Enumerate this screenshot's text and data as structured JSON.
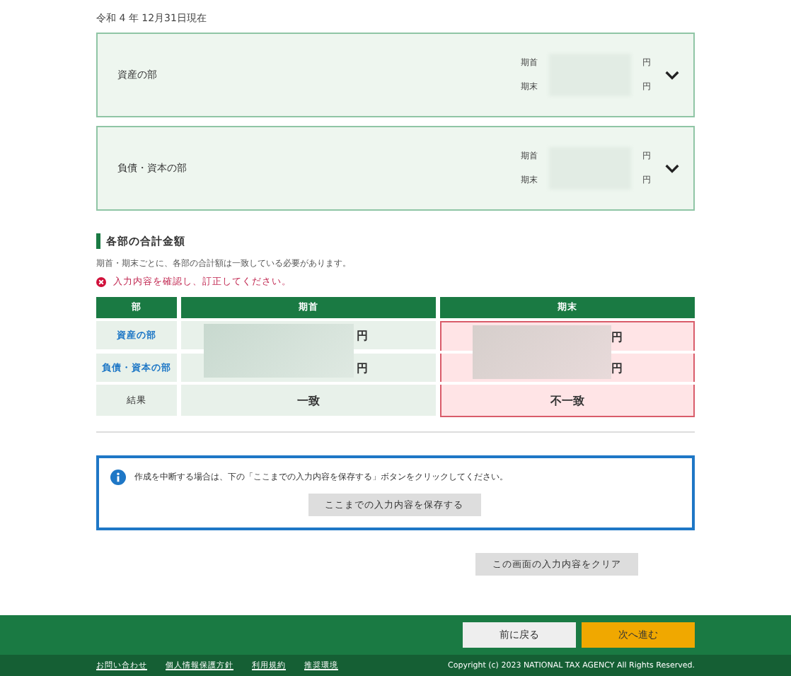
{
  "date": "令和 4 年 12月31日現在",
  "panels": [
    {
      "title": "資産の部",
      "rows": [
        {
          "label": "期首",
          "unit": "円"
        },
        {
          "label": "期末",
          "unit": "円"
        }
      ],
      "expanded": false
    },
    {
      "title": "負債・資本の部",
      "rows": [
        {
          "label": "期首",
          "unit": "円"
        },
        {
          "label": "期末",
          "unit": "円"
        }
      ],
      "expanded": false
    }
  ],
  "totals": {
    "heading": "各部の合計金額",
    "note": "期首・期末ごとに、各部の合計額は一致している必要があります。",
    "error": "入力内容を確認し、訂正してください。",
    "columns": [
      "部",
      "期首",
      "期末"
    ],
    "rows": [
      {
        "kind": "link",
        "cells": [
          {
            "text": "資産の部"
          },
          {
            "unit": "円",
            "error": false
          },
          {
            "unit": "円",
            "error": true
          }
        ]
      },
      {
        "kind": "link",
        "cells": [
          {
            "text": "負債・資本の部"
          },
          {
            "unit": "円",
            "error": false
          },
          {
            "unit": "円",
            "error": true
          }
        ]
      },
      {
        "kind": "result",
        "cells": [
          {
            "text": "結果"
          },
          {
            "text": "一致",
            "error": false
          },
          {
            "text": "不一致",
            "error": true
          }
        ]
      }
    ]
  },
  "info": {
    "text": "作成を中断する場合は、下の「ここまでの入力内容を保存する」ボタンをクリックしてください。",
    "button": "ここまでの入力内容を保存する"
  },
  "clear_button": "この画面の入力内容をクリア",
  "nav": {
    "back": "前に戻る",
    "next": "次へ進む"
  },
  "footer": {
    "links": [
      "お問い合わせ",
      "個人情報保護方針",
      "利用規約",
      "推奨環境"
    ],
    "copyright": "Copyright (c) 2023 NATIONAL TAX AGENCY All Rights Reserved."
  }
}
